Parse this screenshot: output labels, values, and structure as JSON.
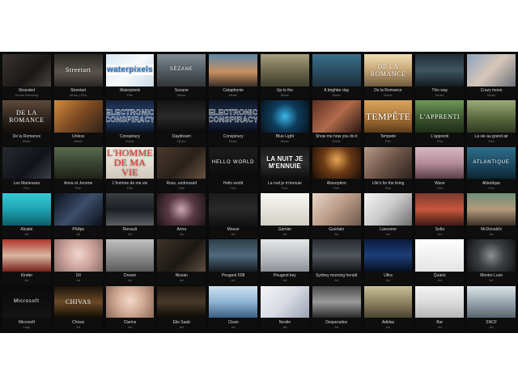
{
  "colors": {
    "background": "#0b0b0b",
    "caption_title": "#d8d8d8",
    "caption_category": "#7a7a7a"
  },
  "rows": [
    [
      {
        "title": "Stranded",
        "category": "Sound Branding",
        "thumb_text": "",
        "bg": "linear-gradient(135deg,#3a3330,#1a1817 60%,#4a4440)"
      },
      {
        "title": "Streetart",
        "category": "Music | Film",
        "thumb_text": "Streetart",
        "style": "t-serif",
        "bg": "linear-gradient(180deg,#2b2724,#5a544c 55%,#2a2622)"
      },
      {
        "title": "Waterpixels",
        "category": "Film",
        "thumb_text": "waterpixels",
        "style": "t-logo",
        "bg": "linear-gradient(135deg,#d8e8f2,#f5f9fb 50%,#c9dbe8)"
      },
      {
        "title": "Sezane",
        "category": "Music",
        "thumb_text": "SÉZANE",
        "style": "t-small",
        "bg": "linear-gradient(180deg,#7f8b92,#4d555b 60%,#2f3438)"
      },
      {
        "title": "Cataphonie",
        "category": "Music",
        "thumb_text": "",
        "bg": "linear-gradient(180deg,#5b86a8,#c7905f 55%,#3a2e2a)"
      },
      {
        "title": "Up to the",
        "category": "Music",
        "thumb_text": "",
        "bg": "linear-gradient(180deg,#a8a080,#6f6a4d 50%,#3c3a2c)"
      },
      {
        "title": "A brighter day",
        "category": "Music",
        "thumb_text": "",
        "bg": "linear-gradient(180deg,#3b6f8c,#2a4e64 50%,#1c2f3a)"
      },
      {
        "title": "De la Romance",
        "category": "Music",
        "thumb_text": "DE LA ROMANCE",
        "style": "t-serif",
        "bg": "linear-gradient(180deg,#f0ddb5,#c7a574 50%,#6e5a3f)"
      },
      {
        "title": "This way",
        "category": "Music",
        "thumb_text": "",
        "bg": "linear-gradient(180deg,#1f2e35,#3e5560 50%,#141c20)"
      },
      {
        "title": "Crazy moon",
        "category": "Music",
        "thumb_text": "",
        "bg": "linear-gradient(135deg,#8ea3bd,#d6c7b8 50%,#6b6f7a)"
      }
    ],
    [
      {
        "title": "De la Romance",
        "category": "Music",
        "thumb_text": "DE LA ROMANCE",
        "style": "t-serif",
        "bg": "linear-gradient(180deg,#5e4a3a,#2a211b 60%,#120e0b)"
      },
      {
        "title": "Unless",
        "category": "Music",
        "thumb_text": "",
        "bg": "linear-gradient(135deg,#d38b3c,#7c4a22 50%,#2e2219)"
      },
      {
        "title": "Conspiracy",
        "category": "Music",
        "thumb_text": "ELECTRONIC CONSPIRACY",
        "style": "t-outline",
        "bg": "linear-gradient(180deg,#152238,#2a4a7c 50%,#0b1220)"
      },
      {
        "title": "Daydream",
        "category": "Music",
        "thumb_text": "",
        "bg": "linear-gradient(180deg,#121212,#2a2a2a 50%,#0a0a0a)"
      },
      {
        "title": "Conspiracy",
        "category": "Music",
        "thumb_text": "ELECTRONIC CONSPIRACY",
        "style": "t-outline",
        "bg": "linear-gradient(180deg,#0d1524,#1f3555 50%,#060a12)"
      },
      {
        "title": "Blue Light",
        "category": "Music",
        "thumb_text": "",
        "bg": "radial-gradient(circle at 50% 50%,#39b6e8,#0f3c5c 45%,#08121c)"
      },
      {
        "title": "Show me how you do it",
        "category": "Music",
        "thumb_text": "",
        "bg": "linear-gradient(135deg,#5c2f24,#b06a4a 50%,#2a1612)"
      },
      {
        "title": "Tempete",
        "category": "Film",
        "thumb_text": "TEMPÊTE",
        "style": "t-big",
        "bg": "linear-gradient(180deg,#d7a45f,#b37a3a 50%,#5b3a1b)"
      },
      {
        "title": "L'apprenti",
        "category": "Film",
        "thumb_text": "L'APPRENTI",
        "style": "t-serif",
        "bg": "linear-gradient(180deg,#6f9a5a,#3d5a30 50%,#1e2c18)"
      },
      {
        "title": "La vie au grand air",
        "category": "Film",
        "thumb_text": "",
        "bg": "linear-gradient(180deg,#9bab7a,#5f6f45 50%,#2f3822)"
      }
    ],
    [
      {
        "title": "Les Marieuses",
        "category": "Film",
        "thumb_text": "",
        "bg": "linear-gradient(135deg,#262a30,#11131a 60%,#3a3f46)"
      },
      {
        "title": "Anna et Jerome",
        "category": "Film",
        "thumb_text": "",
        "bg": "linear-gradient(180deg,#596b4e,#3a4532 50%,#1d2219)"
      },
      {
        "title": "L'homme de ma vie",
        "category": "Film",
        "thumb_text": "L'HOMME DE MA VIE",
        "style": "t-big t-red",
        "bg": "linear-gradient(180deg,#f1ede6,#e3ddd2 50%,#cfc7ba)"
      },
      {
        "title": "Ross, undressed",
        "category": "Film",
        "thumb_text": "",
        "bg": "linear-gradient(135deg,#4b3a2c,#2a211a 55%,#675343)"
      },
      {
        "title": "Hello world",
        "category": "Film",
        "thumb_text": "HELLO WORLD",
        "style": "t-small",
        "bg": "linear-gradient(180deg,#1c1c1c,#0c0c0c)"
      },
      {
        "title": "La nuit je m'ennuie",
        "category": "Film",
        "thumb_text": "LA NUIT JE M'ENNUIE",
        "bg": "linear-gradient(180deg,#1a1a1a,#2e2e2e 50%,#0e0e0e)"
      },
      {
        "title": "Absorption",
        "category": "Film",
        "thumb_text": "",
        "bg": "radial-gradient(circle at 50% 40%,#e5a552,#6b3a16 45%,#1a0e06)"
      },
      {
        "title": "Life's for the living",
        "category": "Film",
        "thumb_text": "",
        "bg": "linear-gradient(135deg,#b89a88,#6f5548 50%,#2c221c)"
      },
      {
        "title": "Wave",
        "category": "Film",
        "thumb_text": "",
        "bg": "linear-gradient(180deg,#d7b8c2,#b58d9c 50%,#5b3e48)"
      },
      {
        "title": "Atlantique",
        "category": "Film",
        "thumb_text": "ATLANTIQUE",
        "style": "t-small",
        "bg": "linear-gradient(180deg,#2f6f8a,#1e4d66 50%,#0c2634)"
      }
    ],
    [
      {
        "title": "Alcatel",
        "category": "Ad",
        "thumb_text": "",
        "bg": "linear-gradient(180deg,#36c9d6,#1fa3b3 50%,#0d5d68)"
      },
      {
        "title": "Philips",
        "category": "Ad",
        "thumb_text": "",
        "bg": "linear-gradient(135deg,#0a0f1a,#3c4e6a 50%,#0a0f1a)"
      },
      {
        "title": "Renault",
        "category": "Ad",
        "thumb_text": "",
        "bg": "linear-gradient(180deg,#3a3f44,#1b1e22 50%,#5b6066)"
      },
      {
        "title": "Anna",
        "category": "Ad",
        "thumb_text": "",
        "bg": "radial-gradient(circle at 50% 50%,#c9a6b2,#5a3a46 45%,#1c1216)"
      },
      {
        "title": "Mouse",
        "category": "Ad",
        "thumb_text": "",
        "bg": "linear-gradient(180deg,#1a1a1a,#2a2a2a 50%,#111)"
      },
      {
        "title": "Garnier",
        "category": "Ad",
        "thumb_text": "",
        "bg": "linear-gradient(180deg,#f7f6f2,#e6e4dd 50%,#d1cec4)"
      },
      {
        "title": "Guerlain",
        "category": "Ad",
        "thumb_text": "",
        "bg": "linear-gradient(135deg,#e8d6c8,#b99a86 50%,#6e574a)"
      },
      {
        "title": "Lancome",
        "category": "Ad",
        "thumb_text": "",
        "bg": "linear-gradient(135deg,#f5f5f5,#c9c9c9 50%,#6e6e6e)"
      },
      {
        "title": "Sofia",
        "category": "Ad",
        "thumb_text": "",
        "bg": "linear-gradient(180deg,#7a3a2e,#c8563e 50%,#3b1a14)"
      },
      {
        "title": "McDonald's",
        "category": "Ad",
        "thumb_text": "",
        "bg": "linear-gradient(180deg,#6f8f7a,#b49a7c 50%,#3a3026)"
      }
    ],
    [
      {
        "title": "Kinder",
        "category": "Ad",
        "thumb_text": "",
        "bg": "linear-gradient(180deg,#b1322a,#d9b8a2 50%,#7a1e18)"
      },
      {
        "title": "Oil",
        "category": "Ad",
        "thumb_text": "",
        "bg": "radial-gradient(circle at 50% 45%,#f0d6cc,#d1a8a0 45%,#8a6c66)"
      },
      {
        "title": "Dream",
        "category": "Ad",
        "thumb_text": "",
        "bg": "linear-gradient(180deg,#bfbfbf,#8f8f8f 50%,#5a5a5a)"
      },
      {
        "title": "Nissan",
        "category": "Ad",
        "thumb_text": "",
        "bg": "linear-gradient(135deg,#3e342a,#1c1814 55%,#5c4d3f)"
      },
      {
        "title": "Peugeot 508",
        "category": "Ad",
        "thumb_text": "",
        "bg": "linear-gradient(180deg,#2e3d4a,#4f6a7c 50%,#141b21)"
      },
      {
        "title": "Peugeot key",
        "category": "Ad",
        "thumb_text": "",
        "bg": "linear-gradient(180deg,#e4e6e8,#bfc3c7 50%,#8c9196)"
      },
      {
        "title": "Sydney morning herald",
        "category": "Ad",
        "thumb_text": "",
        "bg": "linear-gradient(180deg,#262a2e,#51575d 50%,#121417)"
      },
      {
        "title": "Ultra",
        "category": "Ad",
        "thumb_text": "",
        "bg": "linear-gradient(180deg,#0b1a3a,#1c3f7a 50%,#070e1f)"
      },
      {
        "title": "Quartz",
        "category": "Ad",
        "thumb_text": "",
        "bg": "linear-gradient(180deg,#ffffff,#f1f1f1 50%,#e4e4e4)"
      },
      {
        "title": "Montre Luxe",
        "category": "Ad",
        "thumb_text": "",
        "bg": "radial-gradient(circle at 50% 50%,#8d8f94,#3c3e42 45%,#121315)"
      }
    ],
    [
      {
        "title": "Microsoft",
        "category": "Logo",
        "thumb_text": "Microsoft",
        "style": "t-small",
        "bg": "linear-gradient(180deg,#0a0a0a,#141414)"
      },
      {
        "title": "Chivas",
        "category": "Ad",
        "thumb_text": "CHIVAS",
        "style": "t-serif",
        "bg": "linear-gradient(180deg,#1a130c,#6b4a26 50%,#120c06)"
      },
      {
        "title": "Clarins",
        "category": "Ad",
        "thumb_text": "",
        "bg": "radial-gradient(circle at 50% 45%,#f2d8c8,#d2ab96 45%,#8a6a58)"
      },
      {
        "title": "Elie Saab",
        "category": "Ad",
        "thumb_text": "",
        "bg": "linear-gradient(180deg,#1c1712,#4a3a2a 50%,#0c0906)"
      },
      {
        "title": "Clean",
        "category": "Ad",
        "thumb_text": "",
        "bg": "linear-gradient(180deg,#cfe1f0,#8fb4d6 50%,#3c5f80)"
      },
      {
        "title": "Nestle",
        "category": "Ad",
        "thumb_text": "",
        "bg": "linear-gradient(135deg,#f4f4f6,#d8dbe3 50%,#9aa1b3)"
      },
      {
        "title": "Desperados",
        "category": "Ad",
        "thumb_text": "",
        "bg": "linear-gradient(180deg,#4a4a4a,#9a9a9a 50%,#2a2a2a)"
      },
      {
        "title": "Adidas",
        "category": "Ad",
        "thumb_text": "",
        "bg": "linear-gradient(180deg,#c9c09a,#8e8462 50%,#4a4430)"
      },
      {
        "title": "Bar",
        "category": "Ad",
        "thumb_text": "",
        "bg": "linear-gradient(180deg,#f3f3f3,#dcdcdc 50%,#b6b6b6)"
      },
      {
        "title": "SNCF",
        "category": "Ad",
        "thumb_text": "",
        "bg": "linear-gradient(180deg,#dce3e8,#9aa7b0 50%,#5a666e)"
      }
    ]
  ]
}
